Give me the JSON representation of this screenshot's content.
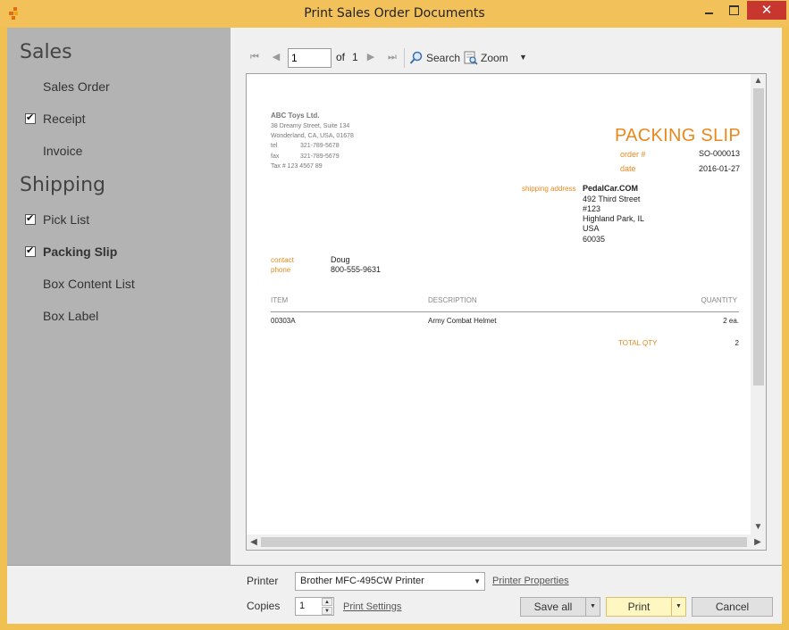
{
  "window": {
    "title": "Print Sales Order Documents",
    "close_glyph": "✕"
  },
  "sidebar": {
    "sales_header": "Sales",
    "shipping_header": "Shipping",
    "sales_items": [
      {
        "label": "Sales Order",
        "checked": false
      },
      {
        "label": "Receipt",
        "checked": true
      },
      {
        "label": "Invoice",
        "checked": false
      }
    ],
    "shipping_items": [
      {
        "label": "Pick List",
        "checked": true
      },
      {
        "label": "Packing Slip",
        "checked": true,
        "selected": true
      },
      {
        "label": "Box Content List",
        "checked": false
      },
      {
        "label": "Box Label",
        "checked": false
      }
    ]
  },
  "toolbar": {
    "page": "1",
    "of_label": "of",
    "total_pages": "1",
    "search_label": "Search",
    "zoom_label": "Zoom"
  },
  "document": {
    "company": {
      "name": "ABC Toys Ltd.",
      "address1": "38 Dreamy Street, Suite 134",
      "address2": "Wonderland, CA, USA, 01678",
      "tel_label": "tel",
      "tel": "321-789-5678",
      "fax_label": "fax",
      "fax": "321-789-5679",
      "tax": "Tax # 123 4567 89"
    },
    "title": "PACKING SLIP",
    "order_label": "order #",
    "order_number": "SO-000013",
    "date_label": "date",
    "date": "2016-01-27",
    "shipping_label": "shipping address",
    "shipping_address": [
      "PedalCar.COM",
      "492 Third Street",
      "#123",
      "Highland Park, IL",
      "USA",
      "60035"
    ],
    "contact_label": "contact",
    "contact": "Doug",
    "phone_label": "phone",
    "phone": "800-555-9631",
    "columns": {
      "item": "ITEM",
      "description": "DESCRIPTION",
      "quantity": "QUANTITY"
    },
    "rows": [
      {
        "item": "00303A",
        "description": "Army Combat Helmet",
        "quantity": "2 ea."
      }
    ],
    "total_qty_label": "TOTAL QTY",
    "total_qty": "2",
    "accent_color": "#e8891d"
  },
  "footer": {
    "printer_label": "Printer",
    "printer": "Brother MFC-495CW Printer",
    "printer_properties": "Printer Properties",
    "copies_label": "Copies",
    "copies": "1",
    "print_settings": "Print Settings",
    "save_all": "Save all",
    "print": "Print",
    "cancel": "Cancel"
  }
}
